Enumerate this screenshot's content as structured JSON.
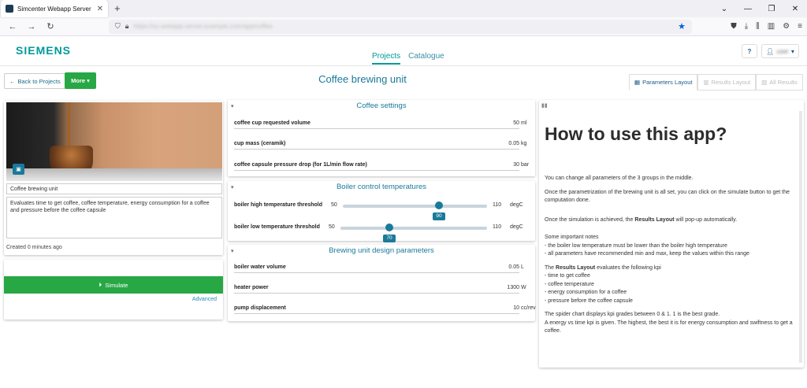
{
  "browser": {
    "tab_title": "Simcenter Webapp Server - Pro",
    "url": "https://sc-webapp-server.example.com/app/coffee"
  },
  "app": {
    "logo": "SIEMENS",
    "nav": [
      "Projects",
      "Catalogue"
    ],
    "help_label": "?",
    "user_name": "user"
  },
  "toolbar": {
    "back_label": "Back to Projects",
    "more_label": "More",
    "page_title": "Coffee brewing unit",
    "layout_tabs": [
      "Parameters Layout",
      "Results Layout",
      "All Results"
    ]
  },
  "project": {
    "name": "Coffee brewing unit",
    "description": "Evaluates time to get coffee, coffee temperature, energy consumption for a coffee and pressure before the coffee capsule",
    "created": "Created 0 minutes ago",
    "simulate_label": "Simulate",
    "advanced_label": "Advanced"
  },
  "coffee_settings": {
    "title": "Coffee settings",
    "params": [
      {
        "label": "coffee cup requested volume",
        "value": "50",
        "unit": "ml"
      },
      {
        "label": "cup mass (ceramik)",
        "value": "0.05",
        "unit": "kg"
      },
      {
        "label": "coffee capsule pressure drop (for 1L/min flow rate)",
        "value": "30",
        "unit": "bar"
      }
    ]
  },
  "boiler": {
    "title": "Boiler control temperatures",
    "sliders": [
      {
        "label": "boiler high temperature threshold",
        "min": "50",
        "max": "110",
        "value": 90,
        "unit": "degC"
      },
      {
        "label": "boiler low temperature threshold",
        "min": "50",
        "max": "110",
        "value": 70,
        "unit": "degC"
      }
    ]
  },
  "design": {
    "title": "Brewing unit design parameters",
    "params": [
      {
        "label": "boiler water volume",
        "value": "0.05",
        "unit": "L"
      },
      {
        "label": "heater power",
        "value": "1300",
        "unit": "W"
      },
      {
        "label": "pump displacement",
        "value": "10",
        "unit": "cc/rev"
      }
    ]
  },
  "howto": {
    "title": "How to use this app?",
    "p1": "You can change all parameters of the 3 groups in the middle.",
    "p2": "Once the parametrization of the brewing unit is all set, you can click on the simulate button to get the computation done.",
    "p3_pre": "Once the simulation is achieved, the ",
    "p3_bold": "Results Layout",
    "p3_post": " will pop-up automatically.",
    "notes_title": "Some important notes",
    "note1": "- the boiler low temperature must be lower than the boiler high temperature",
    "note2": "- all parameters have recommended min and max, keep the values within this range",
    "kpi_pre": "The ",
    "kpi_bold": "Results Layout",
    "kpi_post": " evaluates the following kpi",
    "kpi1": "- time to get coffee",
    "kpi2": "- coffee temperature",
    "kpi3": "- energy consumption for a coffee",
    "kpi4": "- pressure before the coffee capsule",
    "spider1": "The spider chart displays kpi grades between 0 & 1. 1 is the best grade.",
    "spider2": "A energy vs time kpi is given. The highest, the best it is for energy consumption and swiftness to get a coffee."
  },
  "colors": {
    "brand": "#009999",
    "primary": "#1a7a9a",
    "success": "#28a745"
  }
}
